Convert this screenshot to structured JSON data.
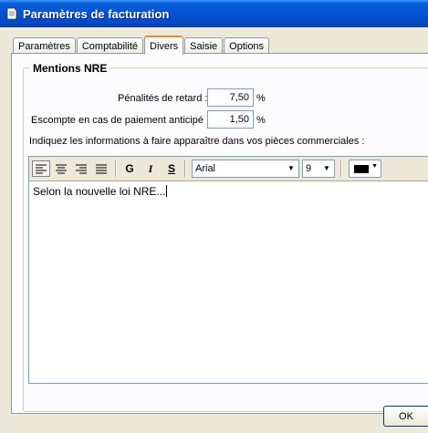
{
  "window": {
    "title": "Paramètres de facturation"
  },
  "tabs": [
    {
      "label": "Paramètres"
    },
    {
      "label": "Comptabilité"
    },
    {
      "label": "Divers",
      "active": true
    },
    {
      "label": "Saisie"
    },
    {
      "label": "Options"
    }
  ],
  "group": {
    "title": "Mentions NRE",
    "penalites_label": "Pénalités de retard :",
    "penalites_value": "7,50",
    "escompte_label": "Escompte en cas de paiement anticipé :",
    "escompte_value": "1,50",
    "percent": "%",
    "info_label": "Indiquez les informations à faire apparaître dans vos pièces commerciales :"
  },
  "toolbar": {
    "bold": "G",
    "italic": "I",
    "strike": "S",
    "font": "Arial",
    "size": "9",
    "color": "#000000"
  },
  "editor": {
    "text": "Selon la nouvelle loi NRE..."
  },
  "buttons": {
    "ok": "OK"
  }
}
